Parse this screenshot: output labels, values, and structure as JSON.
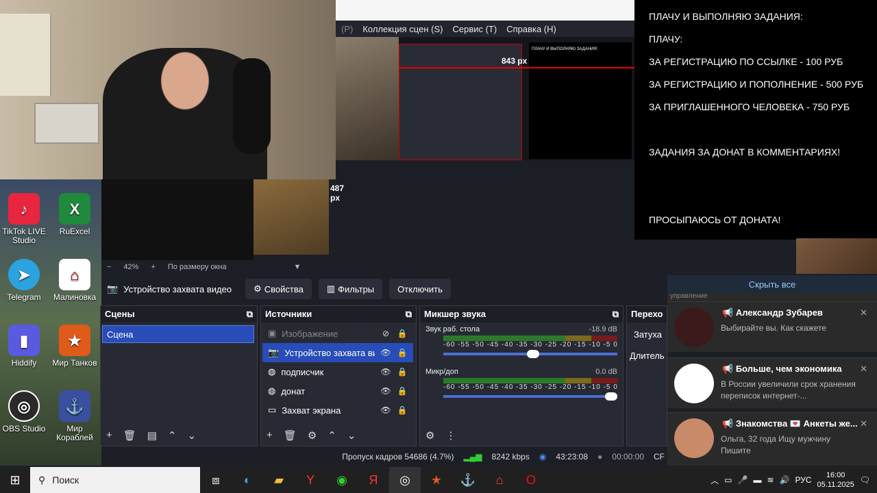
{
  "preview": {
    "menu": [
      "(P)",
      "Коллекция сцен (S)",
      "Сервис (T)",
      "Справка (H)"
    ],
    "px_label_1": "843 px",
    "px_label_2": "487 px"
  },
  "text_panel": {
    "lines": [
      "ПЛАЧУ И ВЫПОЛНЯЮ ЗАДАНИЯ:",
      "ПЛАЧУ:",
      " ЗА РЕГИСТРАЦИЮ ПО ССЫЛКЕ - 100 РУБ",
      "ЗА РЕГИСТРАЦИЮ И ПОПОЛНЕНИЕ - 500 РУБ",
      "ЗА ПРИГЛАШЕННОГО ЧЕЛОВЕКА - 750 РУБ",
      "",
      "ЗАДАНИЯ ЗА ДОНАТ В КОММЕНТАРИЯХ!",
      "",
      "",
      "ПРОСЫПАЮСЬ ОТ ДОНАТА!"
    ]
  },
  "desktop_icons": [
    {
      "label": "TikTok LIVE Studio",
      "icon": "tiktok-icon",
      "color": "#e8263f"
    },
    {
      "label": "RuExcel",
      "icon": "excel-icon",
      "color": "#1f8a3b"
    },
    {
      "label": "Telegram",
      "icon": "telegram-icon",
      "color": "#2aa3de"
    },
    {
      "label": "Малиновка",
      "icon": "malinovka-icon",
      "color": "#ffffff"
    },
    {
      "label": "Hiddify",
      "icon": "hiddify-icon",
      "color": "#5a5ae0"
    },
    {
      "label": "Мир Танков",
      "icon": "tanks-icon",
      "color": "#e05a1a"
    },
    {
      "label": "OBS Studio",
      "icon": "obs-icon",
      "color": "#2a2a2a"
    },
    {
      "label": "Мир Кораблей",
      "icon": "ships-icon",
      "color": "#3a4fa0"
    }
  ],
  "zoom": {
    "percent": "42%",
    "fit": "По размеру окна"
  },
  "toolbar": {
    "source_name": "Устройство захвата видео",
    "properties": "Свойства",
    "filters": "Фильтры",
    "disable": "Отключить"
  },
  "scenes": {
    "title": "Сцены",
    "items": [
      "Сцена"
    ]
  },
  "sources": {
    "title": "Источники",
    "items": [
      {
        "name": "Изображение",
        "icon": "image-icon",
        "state": "hidden"
      },
      {
        "name": "Устройство захвата ви,",
        "icon": "camera-icon",
        "state": "selected"
      },
      {
        "name": "подписчик",
        "icon": "browser-icon",
        "state": "normal"
      },
      {
        "name": "донат",
        "icon": "browser-icon",
        "state": "normal"
      },
      {
        "name": "Захват экрана",
        "icon": "monitor-icon",
        "state": "normal"
      }
    ]
  },
  "mixer": {
    "title": "Микшер звука",
    "channels": [
      {
        "name": "Звук раб. стола",
        "db": "-18.9 dB",
        "level": 0.55
      },
      {
        "name": "Микр/доп",
        "db": "0.0 dB",
        "level": 1.0
      }
    ],
    "scale": "-60 -55 -50 -45 -40 -35 -30 -25 -20 -15 -10 -5 0"
  },
  "transitions": {
    "title": "Перехо",
    "fade": "Затуха",
    "duration": "Длитель"
  },
  "notifications": {
    "hide_all": "Скрыть все",
    "header_partial": "управление",
    "items": [
      {
        "title": "Александр Зубарев",
        "body": "Выбирайте вы. Как скажете",
        "avatar_color": "#3a1a1a"
      },
      {
        "title": "Больше, чем экономика",
        "body": "В России увеличили срок хранения переписок интернет-...",
        "avatar_color": "#ffffff"
      },
      {
        "title": "Знакомства 💌 Анкеты же...",
        "body": "Ольга, 32 года Ищу мужчину Пишите",
        "avatar_color": "#c98a6a"
      }
    ]
  },
  "status": {
    "dropped": "Пропуск кадров 54686 (4.7%)",
    "kbps": "8242 kbps",
    "live_time": "43:23:08",
    "rec_time": "00:00:00",
    "cpu_partial": "CF"
  },
  "taskbar": {
    "search": "Поиск",
    "lang": "РУС",
    "time": "16:00",
    "date": "05.11.2025"
  }
}
